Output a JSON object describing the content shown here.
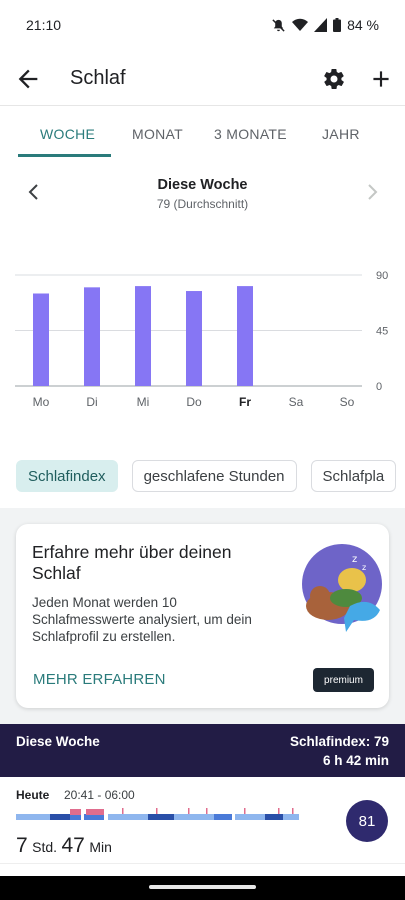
{
  "status_bar": {
    "time": "21:10",
    "battery": "84 %",
    "icons": [
      "mute-icon",
      "wifi-icon",
      "signal-icon",
      "battery-icon"
    ]
  },
  "app_bar": {
    "title": "Schlaf",
    "icons": [
      "back-arrow-icon",
      "gear-icon",
      "plus-icon"
    ]
  },
  "tabs": [
    {
      "label": "WOCHE",
      "active": true
    },
    {
      "label": "MONAT",
      "active": false
    },
    {
      "label": "3 MONATE",
      "active": false
    },
    {
      "label": "JAHR",
      "active": false
    }
  ],
  "week_nav": {
    "title": "Diese Woche",
    "subtitle": "79 (Durchschnitt)"
  },
  "chart_data": {
    "type": "bar",
    "categories": [
      "Mo",
      "Di",
      "Mi",
      "Do",
      "Fr",
      "Sa",
      "So"
    ],
    "values": [
      75,
      80,
      81,
      77,
      81,
      null,
      null
    ],
    "highlight_category": "Fr",
    "ylim": [
      0,
      90
    ],
    "y_ticks": [
      "90",
      "45",
      "0"
    ],
    "grid": true,
    "bar_color": "#8676f4"
  },
  "chips": [
    {
      "label": "Schlafindex",
      "active": true
    },
    {
      "label": "geschlafene Stunden",
      "active": false
    },
    {
      "label": "Schlafpla",
      "active": false
    }
  ],
  "promo_card": {
    "title": "Erfahre mehr über deinen Schlaf",
    "body": "Jeden Monat werden 10 Schlafmesswerte analysiert, um dein Schlafprofil zu erstellen.",
    "link": "MEHR ERFAHREN",
    "badge": "premium"
  },
  "summary": {
    "left": "Diese Woche",
    "score": "Schlafindex: 79",
    "duration": "6 h 42 min"
  },
  "entry": {
    "day": "Heute",
    "range": "20:41 - 06:00",
    "hours": "7",
    "hours_unit": "Std.",
    "minutes": "47",
    "minutes_unit": "Min",
    "score": "81"
  },
  "colors": {
    "accent": "#2a7b7b",
    "bar": "#8676f4",
    "summary_bg": "#221c45",
    "score_bg": "#2f2a6e"
  }
}
